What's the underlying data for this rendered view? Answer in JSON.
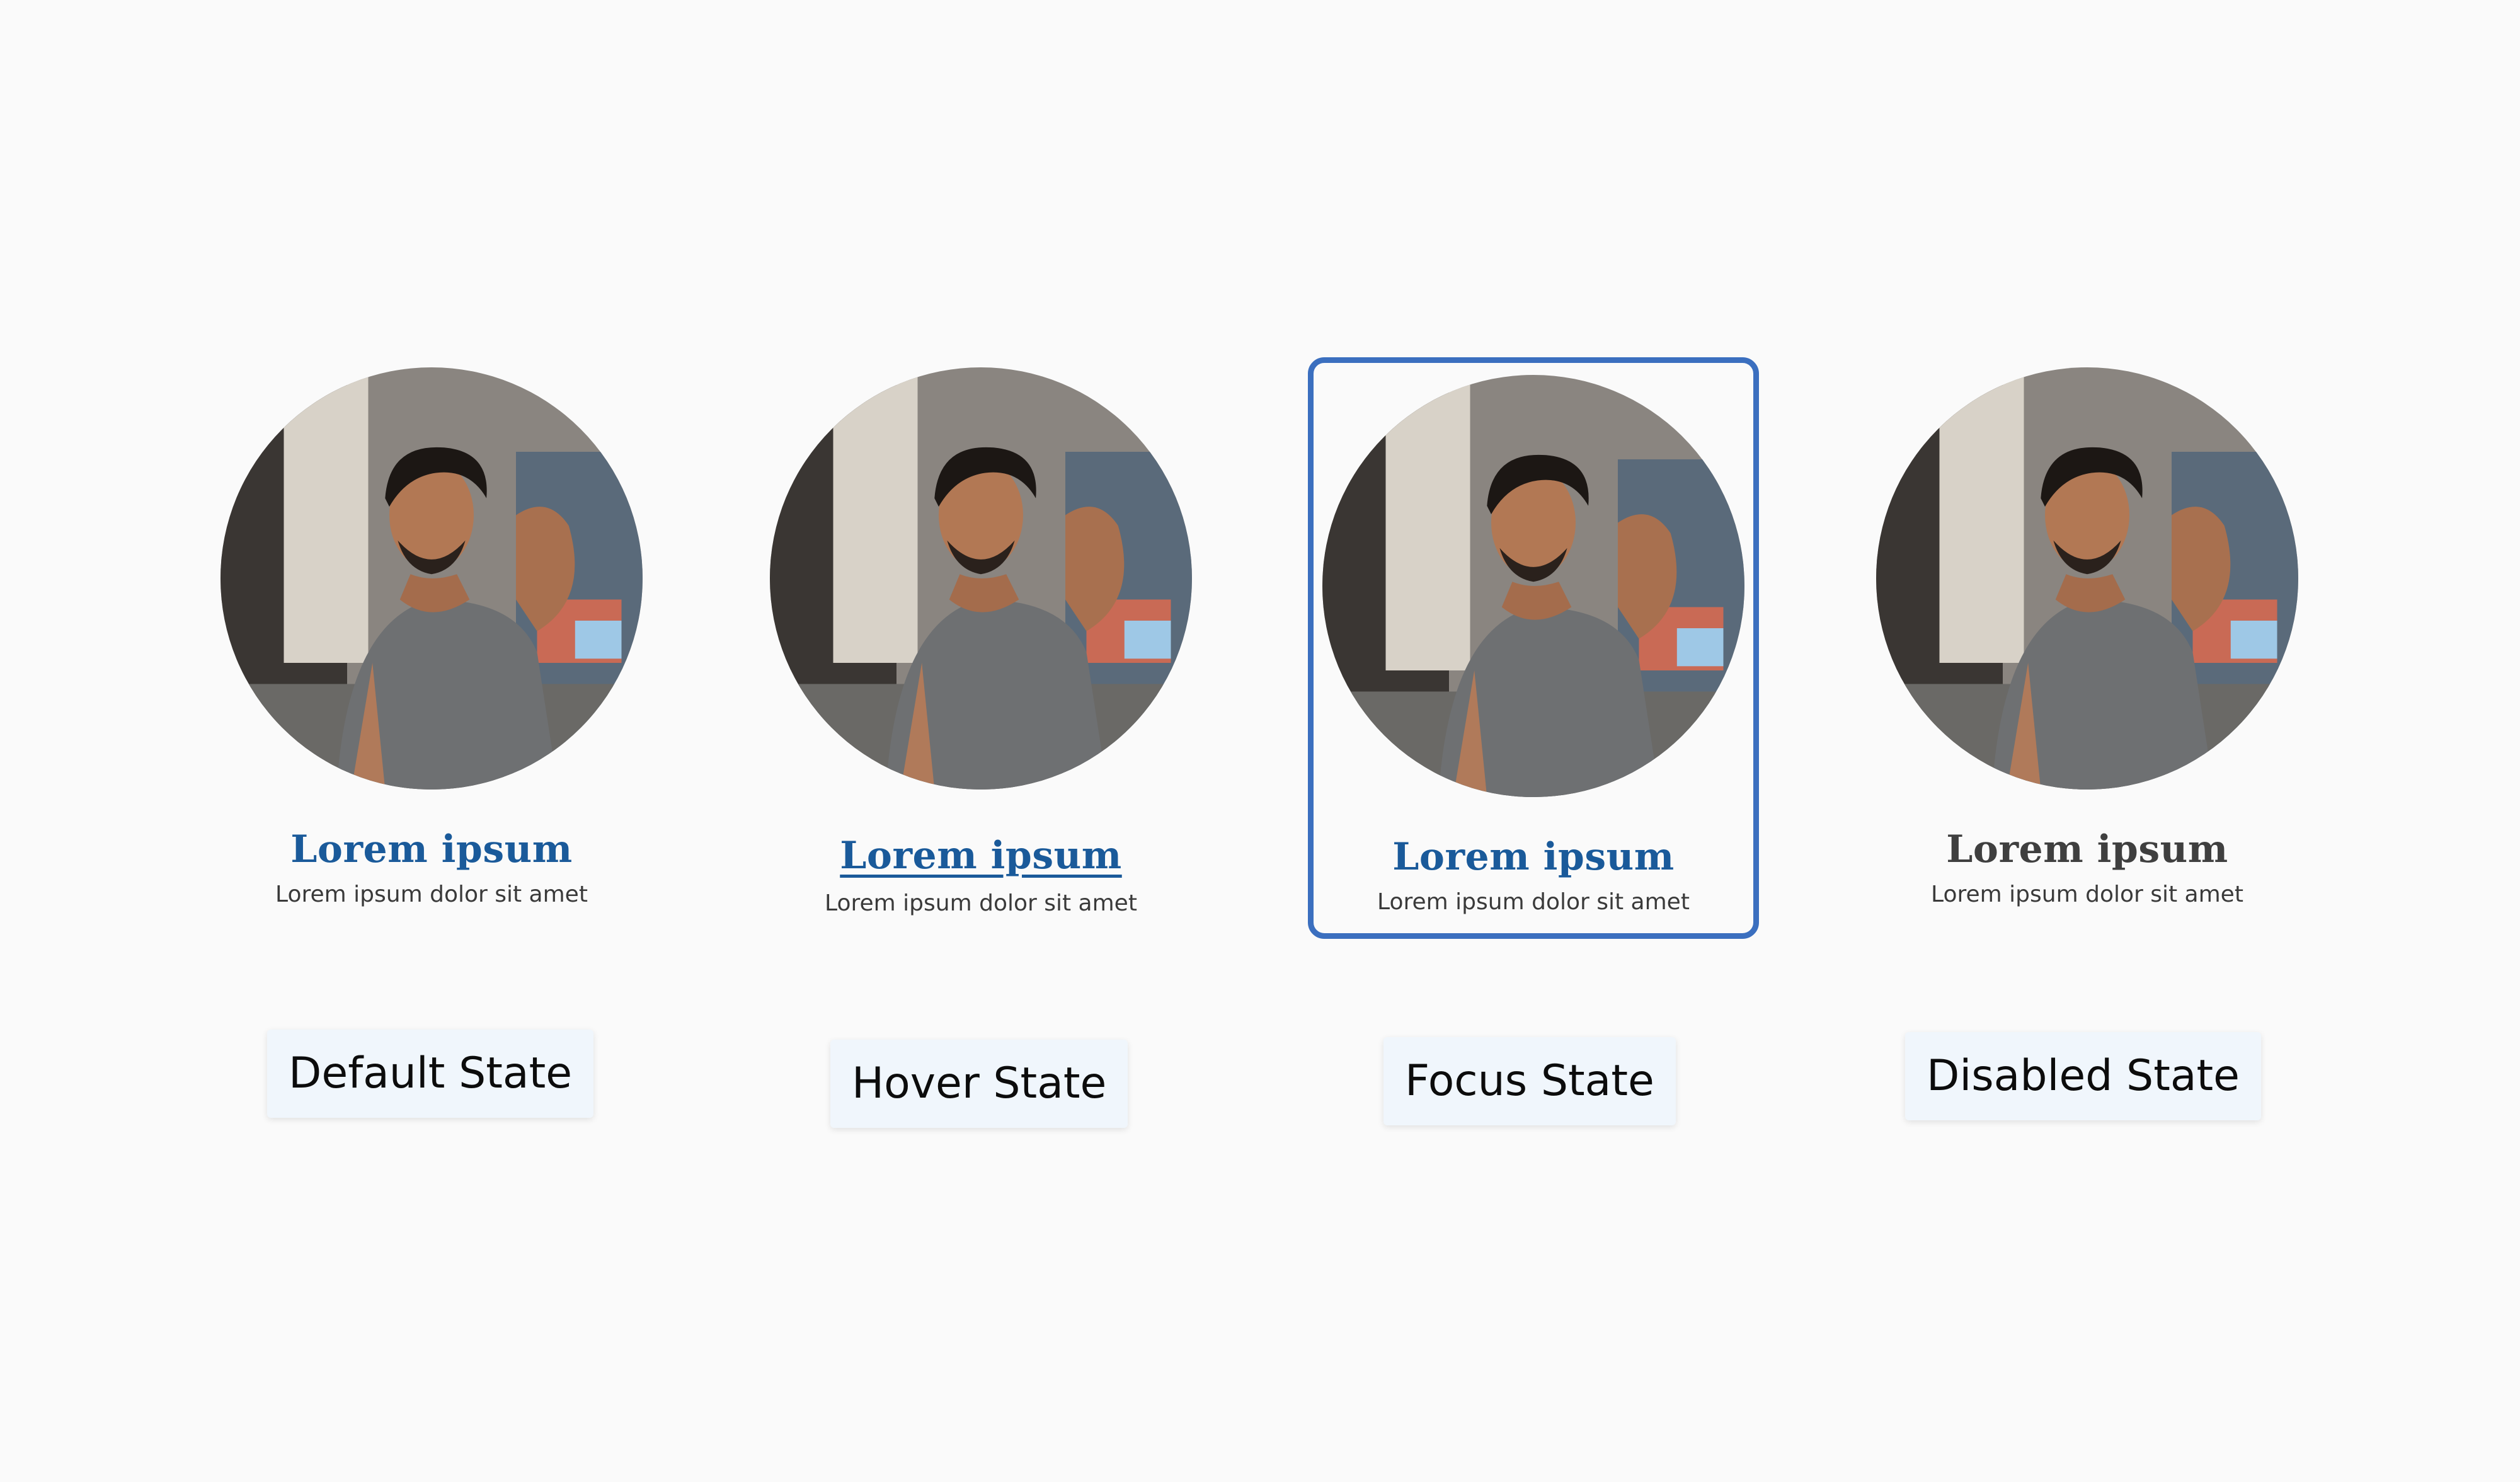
{
  "cards": [
    {
      "name": "Lorem ipsum",
      "description": "Lorem ipsum dolor sit amet",
      "state_label": "Default State"
    },
    {
      "name": "Lorem ipsum",
      "description": "Lorem ipsum dolor sit amet",
      "state_label": "Hover State"
    },
    {
      "name": "Lorem ipsum",
      "description": "Lorem ipsum dolor sit amet",
      "state_label": "Focus State"
    },
    {
      "name": "Lorem ipsum",
      "description": "Lorem ipsum dolor sit amet",
      "state_label": "Disabled State"
    }
  ],
  "colors": {
    "link": "#1a5a9a",
    "disabled_text": "#3f3f3f",
    "focus_ring": "#3b6fbf",
    "label_bg": "#f0f6fc",
    "page_bg": "#fafafa"
  },
  "icons": {
    "avatar": "person-photo-avatar"
  }
}
